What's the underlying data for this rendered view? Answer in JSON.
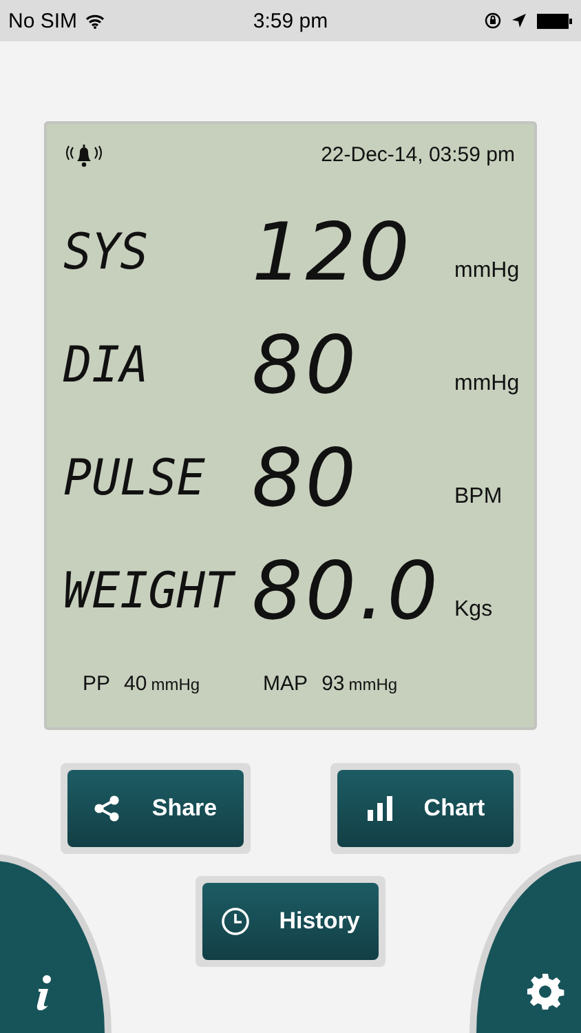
{
  "status_bar": {
    "carrier": "No SIM",
    "time": "3:59 pm"
  },
  "display": {
    "datetime": "22-Dec-14, 03:59 pm",
    "readings": [
      {
        "label": "SYS",
        "value": "120",
        "unit": "mmHg"
      },
      {
        "label": "DIA",
        "value": "80",
        "unit": "mmHg"
      },
      {
        "label": "PULSE",
        "value": "80",
        "unit": "BPM"
      },
      {
        "label": "WEIGHT",
        "value": "80.0",
        "unit": "Kgs"
      }
    ],
    "footer": [
      {
        "label": "PP",
        "value": "40",
        "unit": "mmHg"
      },
      {
        "label": "MAP",
        "value": "93",
        "unit": "mmHg"
      }
    ]
  },
  "buttons": [
    {
      "kind": "share",
      "label": "Share"
    },
    {
      "kind": "chart",
      "label": "Chart"
    },
    {
      "kind": "history",
      "label": "History"
    }
  ]
}
